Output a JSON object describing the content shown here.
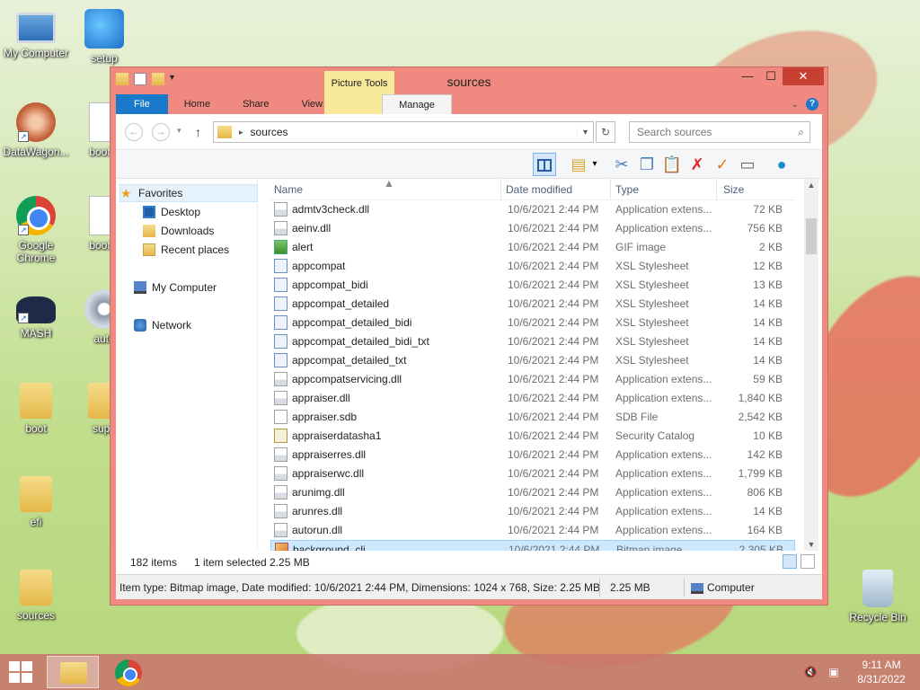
{
  "desktop": {
    "icons": [
      {
        "label": "My Computer"
      },
      {
        "label": "setup"
      },
      {
        "label": "DataWagon..."
      },
      {
        "label": "bootm"
      },
      {
        "label": "Google Chrome"
      },
      {
        "label": "bootm"
      },
      {
        "label": "MASH"
      },
      {
        "label": "auto"
      },
      {
        "label": "boot"
      },
      {
        "label": "supp"
      },
      {
        "label": "efi"
      },
      {
        "label": "sources"
      },
      {
        "label": "Recycle Bin"
      }
    ]
  },
  "window": {
    "title": "sources",
    "context_tab_group": "Picture Tools",
    "ribbon_tabs": [
      "File",
      "Home",
      "Share",
      "View",
      "Manage"
    ],
    "address": {
      "path": "sources"
    },
    "search": {
      "placeholder": "Search sources"
    },
    "nav": {
      "favorites": "Favorites",
      "desktop": "Desktop",
      "downloads": "Downloads",
      "recent": "Recent places",
      "computer": "My Computer",
      "network": "Network"
    },
    "columns": {
      "name": "Name",
      "date": "Date modified",
      "type": "Type",
      "size": "Size"
    },
    "files": [
      {
        "name": "admtv3check.dll",
        "date": "10/6/2021 2:44 PM",
        "type": "Application extens...",
        "size": "72 KB",
        "icon": "dll"
      },
      {
        "name": "aeinv.dll",
        "date": "10/6/2021 2:44 PM",
        "type": "Application extens...",
        "size": "756 KB",
        "icon": "dll"
      },
      {
        "name": "alert",
        "date": "10/6/2021 2:44 PM",
        "type": "GIF image",
        "size": "2 KB",
        "icon": "gif"
      },
      {
        "name": "appcompat",
        "date": "10/6/2021 2:44 PM",
        "type": "XSL Stylesheet",
        "size": "12 KB",
        "icon": "xsl"
      },
      {
        "name": "appcompat_bidi",
        "date": "10/6/2021 2:44 PM",
        "type": "XSL Stylesheet",
        "size": "13 KB",
        "icon": "xsl"
      },
      {
        "name": "appcompat_detailed",
        "date": "10/6/2021 2:44 PM",
        "type": "XSL Stylesheet",
        "size": "14 KB",
        "icon": "xsl"
      },
      {
        "name": "appcompat_detailed_bidi",
        "date": "10/6/2021 2:44 PM",
        "type": "XSL Stylesheet",
        "size": "14 KB",
        "icon": "xsl"
      },
      {
        "name": "appcompat_detailed_bidi_txt",
        "date": "10/6/2021 2:44 PM",
        "type": "XSL Stylesheet",
        "size": "14 KB",
        "icon": "xsl"
      },
      {
        "name": "appcompat_detailed_txt",
        "date": "10/6/2021 2:44 PM",
        "type": "XSL Stylesheet",
        "size": "14 KB",
        "icon": "xsl"
      },
      {
        "name": "appcompatservicing.dll",
        "date": "10/6/2021 2:44 PM",
        "type": "Application extens...",
        "size": "59 KB",
        "icon": "dll"
      },
      {
        "name": "appraiser.dll",
        "date": "10/6/2021 2:44 PM",
        "type": "Application extens...",
        "size": "1,840 KB",
        "icon": "dll"
      },
      {
        "name": "appraiser.sdb",
        "date": "10/6/2021 2:44 PM",
        "type": "SDB File",
        "size": "2,542 KB",
        "icon": "blank"
      },
      {
        "name": "appraiserdatasha1",
        "date": "10/6/2021 2:44 PM",
        "type": "Security Catalog",
        "size": "10 KB",
        "icon": "cat"
      },
      {
        "name": "appraiserres.dll",
        "date": "10/6/2021 2:44 PM",
        "type": "Application extens...",
        "size": "142 KB",
        "icon": "dll"
      },
      {
        "name": "appraiserwc.dll",
        "date": "10/6/2021 2:44 PM",
        "type": "Application extens...",
        "size": "1,799 KB",
        "icon": "dll"
      },
      {
        "name": "arunimg.dll",
        "date": "10/6/2021 2:44 PM",
        "type": "Application extens...",
        "size": "806 KB",
        "icon": "dll"
      },
      {
        "name": "arunres.dll",
        "date": "10/6/2021 2:44 PM",
        "type": "Application extens...",
        "size": "14 KB",
        "icon": "dll"
      },
      {
        "name": "autorun.dll",
        "date": "10/6/2021 2:44 PM",
        "type": "Application extens...",
        "size": "164 KB",
        "icon": "dll"
      },
      {
        "name": "background_cli",
        "date": "10/6/2021 2:44 PM",
        "type": "Bitmap image",
        "size": "2,305 KB",
        "icon": "bmp",
        "selected": true
      }
    ],
    "status": {
      "item_count": "182 items",
      "selected": "1 item selected  2.25 MB",
      "details": "Item type: Bitmap image, Date modified: 10/6/2021 2:44 PM, Dimensions: 1024 x 768, Size: 2.25 MB",
      "size": "2.25 MB",
      "location": "Computer"
    }
  },
  "taskbar": {
    "time": "9:11 AM",
    "date": "8/31/2022"
  }
}
